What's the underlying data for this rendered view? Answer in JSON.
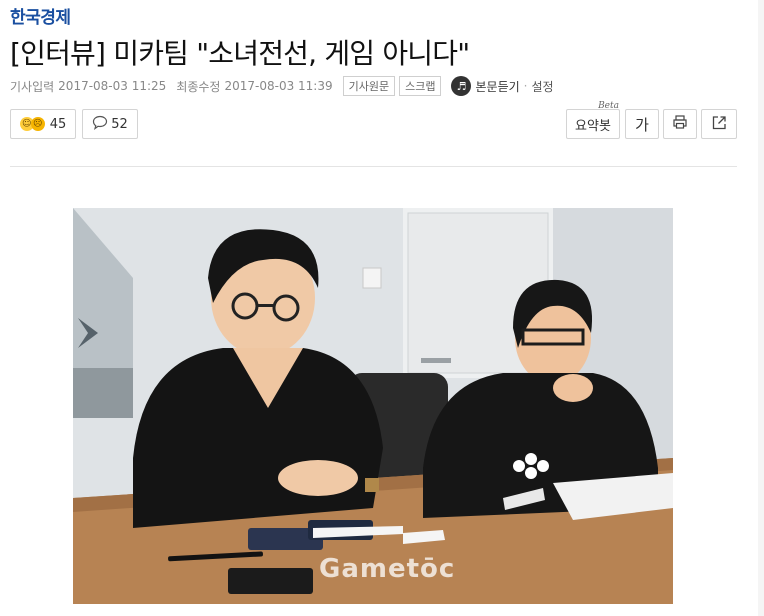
{
  "brand": "한국경제",
  "headline": "[인터뷰] 미카팀 \"소녀전선, 게임 아니다\"",
  "meta": {
    "input_label": "기사입력",
    "input_time": "2017-08-03 11:25",
    "edit_label": "최종수정",
    "edit_time": "2017-08-03 11:39",
    "original_btn": "기사원문",
    "scrap_btn": "스크랩",
    "listen_label": "본문듣기",
    "listen_dot": "·",
    "settings_label": "설정"
  },
  "toolbar": {
    "reaction_count": "45",
    "comment_count": "52",
    "summary_label": "요약봇",
    "summary_beta": "Beta",
    "font_label": "가"
  },
  "photo": {
    "watermark": "Gametōc"
  }
}
